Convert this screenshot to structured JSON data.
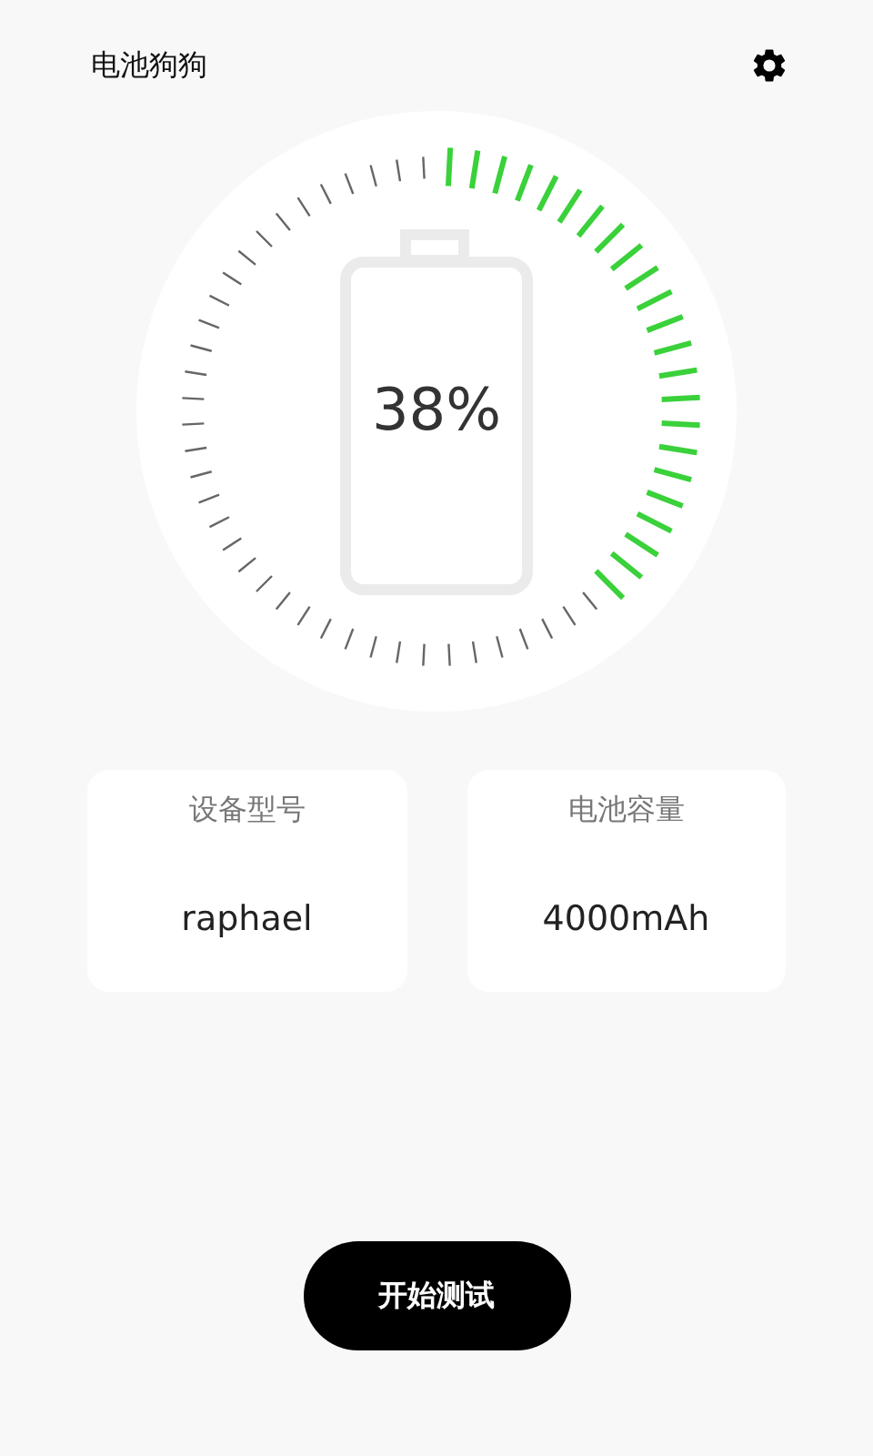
{
  "app_bar": {
    "title": "电池狗狗"
  },
  "battery": {
    "percent": "38%"
  },
  "info_cards": [
    {
      "label": "设备型号",
      "value": "raphael"
    },
    {
      "label": "电池容量",
      "value": "4000mAh"
    }
  ],
  "start_button": {
    "label": "开始测试"
  }
}
